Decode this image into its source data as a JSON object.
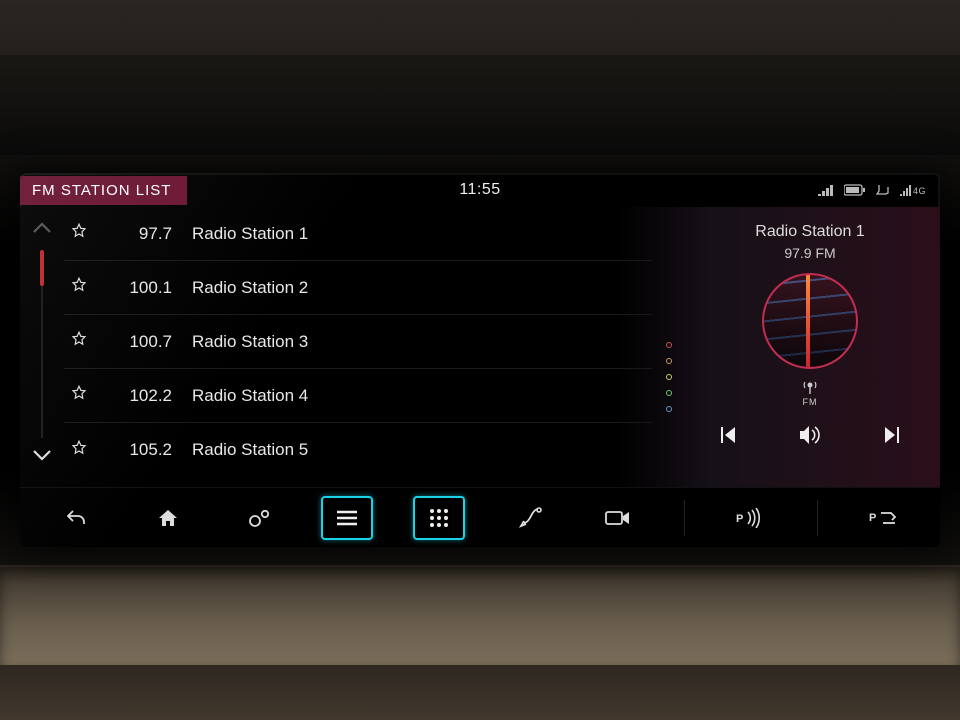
{
  "header": {
    "title": "FM STATION LIST",
    "clock": "11:55"
  },
  "stations": [
    {
      "freq": "97.7",
      "name": "Radio Station 1"
    },
    {
      "freq": "100.1",
      "name": "Radio Station 2"
    },
    {
      "freq": "100.7",
      "name": "Radio Station 3"
    },
    {
      "freq": "102.2",
      "name": "Radio Station 4"
    },
    {
      "freq": "105.2",
      "name": "Radio Station 5"
    }
  ],
  "now_playing": {
    "name": "Radio Station 1",
    "freq": "97.9 FM",
    "band_label": "FM"
  },
  "icons": {
    "signal_4g": "4G"
  }
}
